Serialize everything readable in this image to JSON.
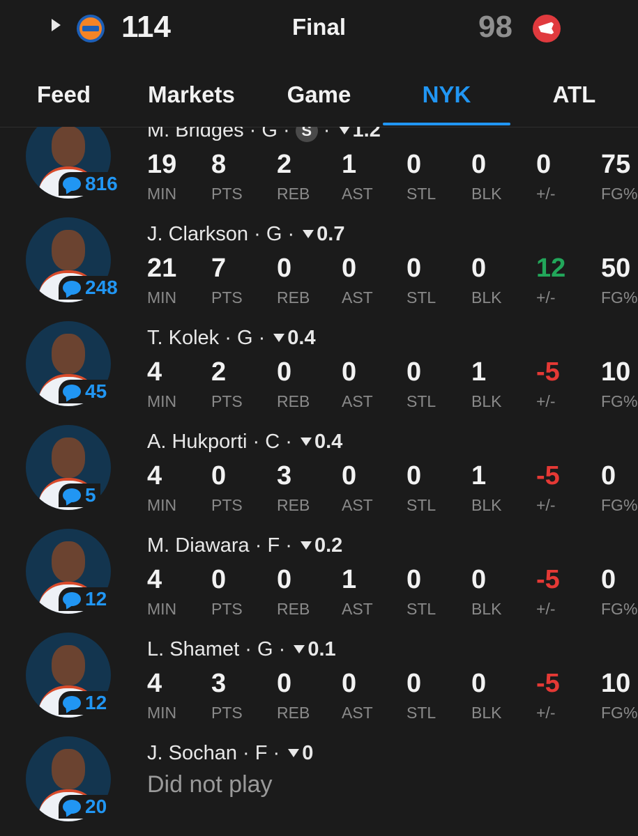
{
  "scoreboard": {
    "home_team_logo": "knicks-logo",
    "home_score": "114",
    "status": "Final",
    "away_score": "98",
    "away_team_logo": "hawks-logo"
  },
  "tabs": [
    "Feed",
    "Markets",
    "Game",
    "NYK",
    "ATL"
  ],
  "active_tab": "NYK",
  "stat_labels": [
    "MIN",
    "PTS",
    "REB",
    "AST",
    "STL",
    "BLK",
    "+/-",
    "FG%"
  ],
  "colors": {
    "accent": "#2196f3",
    "positive": "#22a65a",
    "negative": "#e53935"
  },
  "players": [
    {
      "name": "M. Bridges",
      "position": "G",
      "starter_badge": "S",
      "fantasy": "1.2",
      "comments": "816",
      "stats": [
        "19",
        "8",
        "2",
        "1",
        "0",
        "0",
        "0",
        "75"
      ]
    },
    {
      "name": "J. Clarkson",
      "position": "G",
      "fantasy": "0.7",
      "comments": "248",
      "stats": [
        "21",
        "7",
        "0",
        "0",
        "0",
        "0",
        "12",
        "50"
      ]
    },
    {
      "name": "T. Kolek",
      "position": "G",
      "fantasy": "0.4",
      "comments": "45",
      "stats": [
        "4",
        "2",
        "0",
        "0",
        "0",
        "1",
        "-5",
        "10"
      ]
    },
    {
      "name": "A. Hukporti",
      "position": "C",
      "fantasy": "0.4",
      "comments": "5",
      "stats": [
        "4",
        "0",
        "3",
        "0",
        "0",
        "1",
        "-5",
        "0"
      ]
    },
    {
      "name": "M. Diawara",
      "position": "F",
      "fantasy": "0.2",
      "comments": "12",
      "stats": [
        "4",
        "0",
        "0",
        "1",
        "0",
        "0",
        "-5",
        "0"
      ]
    },
    {
      "name": "L. Shamet",
      "position": "G",
      "fantasy": "0.1",
      "comments": "12",
      "stats": [
        "4",
        "3",
        "0",
        "0",
        "0",
        "0",
        "-5",
        "10"
      ]
    },
    {
      "name": "J. Sochan",
      "position": "F",
      "fantasy": "0",
      "comments": "20",
      "dnp": "Did not play"
    }
  ]
}
